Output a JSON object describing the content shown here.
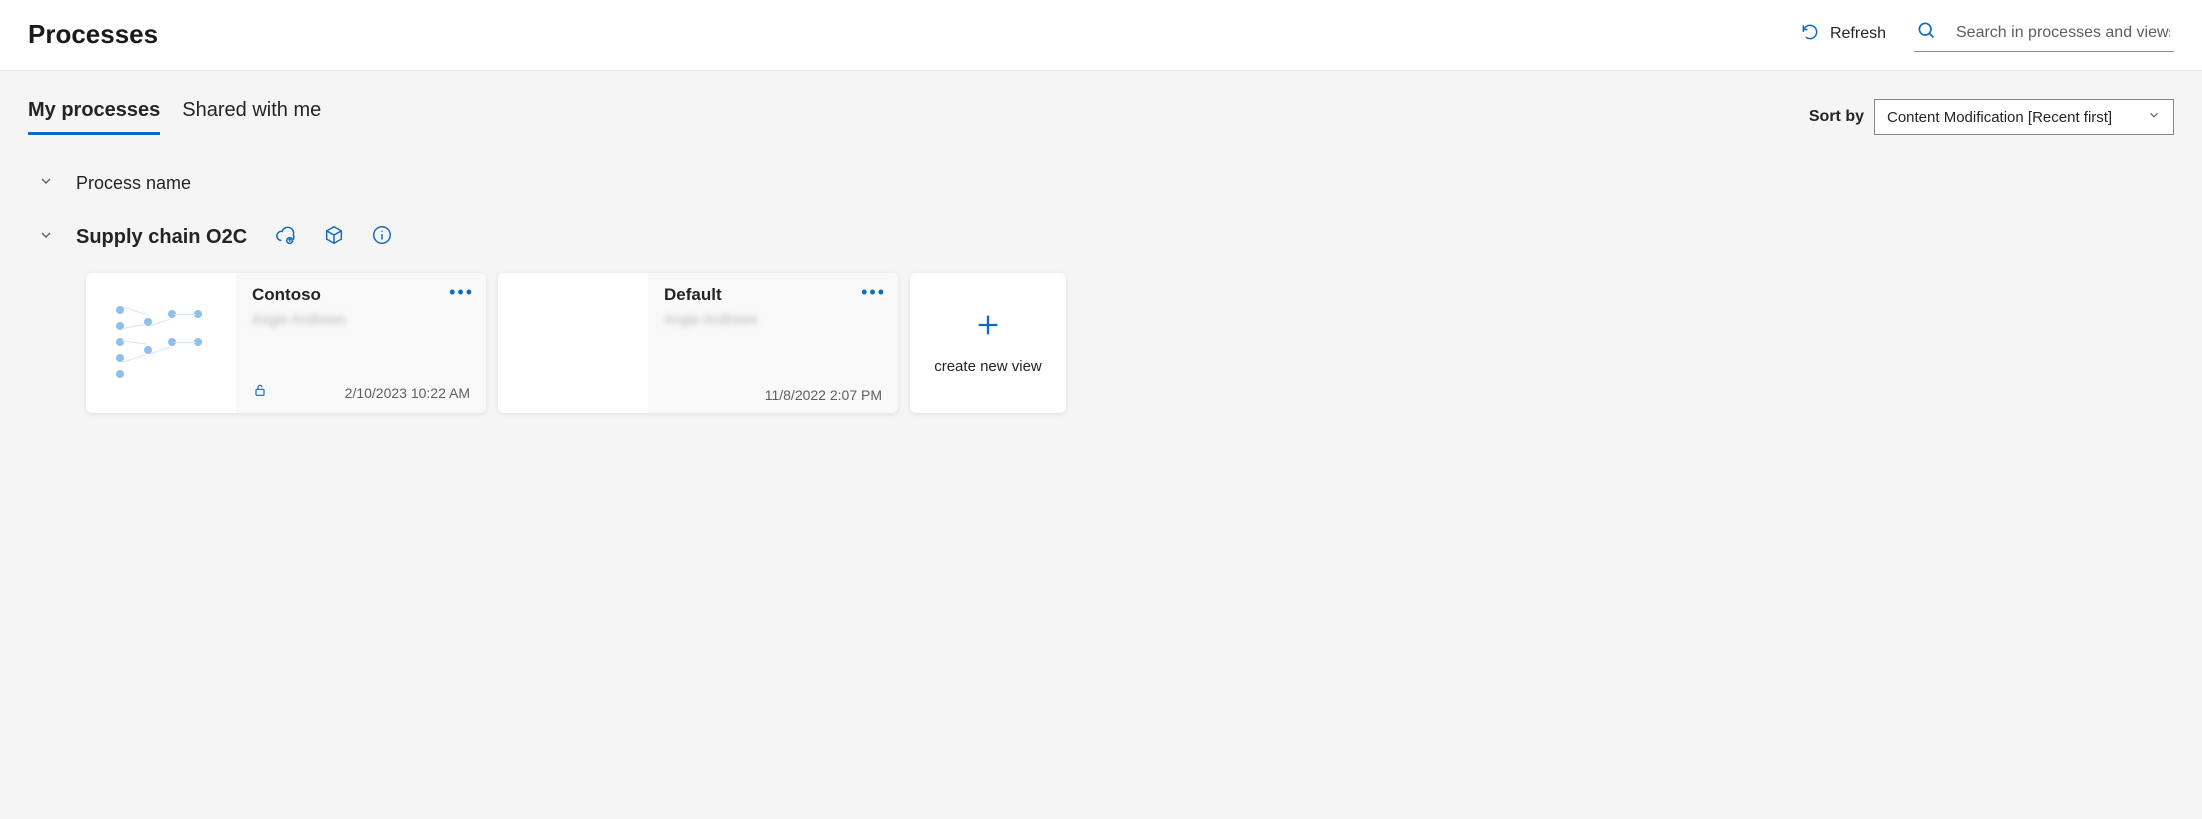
{
  "header": {
    "title": "Processes",
    "refresh_label": "Refresh",
    "search_placeholder": "Search in processes and views"
  },
  "tabs": {
    "my_processes": "My processes",
    "shared_with_me": "Shared with me"
  },
  "sort": {
    "label": "Sort by",
    "selected": "Content Modification [Recent first]"
  },
  "group_header": "Process name",
  "process": {
    "name": "Supply chain O2C"
  },
  "cards": [
    {
      "title": "Contoso",
      "owner": "Angie Andrews",
      "date": "2/10/2023 10:22 AM",
      "locked": true
    },
    {
      "title": "Default",
      "owner": "Angie Andrews",
      "date": "11/8/2022 2:07 PM",
      "locked": false
    }
  ],
  "new_view_label": "create new view"
}
